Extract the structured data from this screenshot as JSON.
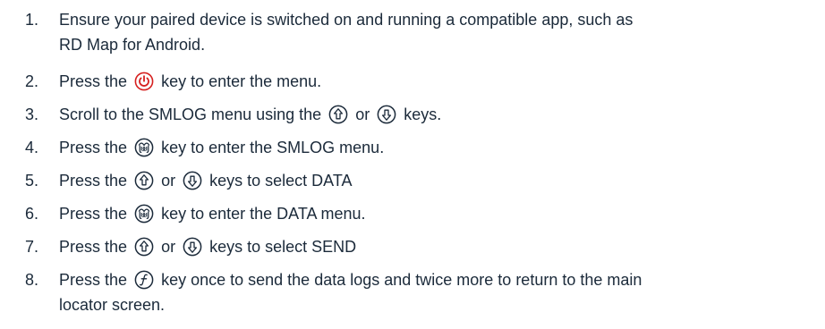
{
  "steps": [
    {
      "number": "1.",
      "line1": "Ensure your paired device is switched on and running a compatible app, such as",
      "line2": "RD Map for Android."
    },
    {
      "number": "2.",
      "before": "Press the",
      "icon": "power-key-icon",
      "after": "key to enter the menu."
    },
    {
      "number": "3.",
      "before": "Scroll to the SMLOG menu using the",
      "icon1": "up-arrow-key-icon",
      "middle": "or",
      "icon2": "down-arrow-key-icon",
      "after": "keys."
    },
    {
      "number": "4.",
      "before": "Press the",
      "icon": "antenna-key-icon",
      "after": "key to enter the SMLOG menu."
    },
    {
      "number": "5.",
      "before": "Press the",
      "icon1": "up-arrow-key-icon",
      "middle": "or",
      "icon2": "down-arrow-key-icon",
      "after": "keys to select DATA"
    },
    {
      "number": "6.",
      "before": "Press the",
      "icon": "antenna-key-icon",
      "after": "key to enter the DATA menu."
    },
    {
      "number": "7.",
      "before": "Press the",
      "icon1": "up-arrow-key-icon",
      "middle": "or",
      "icon2": "down-arrow-key-icon",
      "after": "keys to select SEND"
    },
    {
      "number": "8.",
      "before": "Press the",
      "icon": "function-key-icon",
      "after": "key once to send the data logs and twice more to return to the main",
      "line2": "locator screen."
    }
  ],
  "colors": {
    "text": "#1b2a3a",
    "power_icon": "#d6201f",
    "key_outline": "#1b2a3a"
  }
}
